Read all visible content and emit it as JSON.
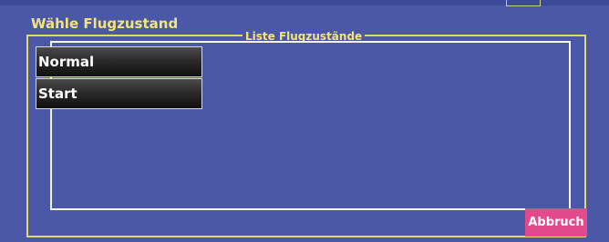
{
  "dialog": {
    "title": "Wähle Flugzustand",
    "group_label": "Liste Flugzustände",
    "cancel_label": "Abbruch",
    "accent_color": "#f1e57a",
    "cancel_color": "#e34a8c"
  },
  "list": {
    "items": [
      {
        "label": "Normal"
      },
      {
        "label": "Start"
      }
    ]
  }
}
